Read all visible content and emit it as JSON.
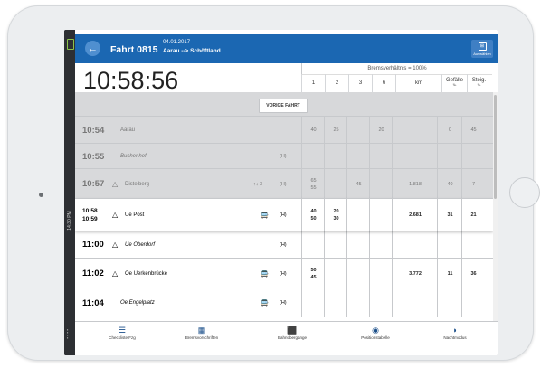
{
  "header": {
    "back_icon": "arrow-left-icon",
    "trip_title": "Fahrt 0815",
    "date": "04.01.2017",
    "route": "Aarau --> Schöftland",
    "select_label": "Auswählen",
    "brand_color": "#1b67b2"
  },
  "status": {
    "time_vertical": "14:30 PM"
  },
  "clock": "10:58:56",
  "brake_ratio": "Bremsverhältnis = 100%",
  "columns": [
    {
      "label": "1",
      "sub": ""
    },
    {
      "label": "2",
      "sub": ""
    },
    {
      "label": "3",
      "sub": ""
    },
    {
      "label": "6",
      "sub": ""
    },
    {
      "label": "km",
      "sub": ""
    },
    {
      "label": "Gefälle",
      "sub": "‰"
    },
    {
      "label": "Steig.",
      "sub": "‰"
    }
  ],
  "prev_button": "VORIGE FAHRT",
  "rows": [
    {
      "state": "past",
      "time": "10:54",
      "time2": "",
      "symbol": "",
      "name": "Aarau",
      "italic": false,
      "bus": false,
      "arrows": "",
      "h": "",
      "cells": [
        "40",
        "25",
        "",
        "20",
        "",
        "0",
        "45"
      ]
    },
    {
      "state": "past",
      "time": "10:55",
      "time2": "",
      "symbol": "",
      "name": "Buchenhof",
      "italic": true,
      "bus": false,
      "arrows": "",
      "h": "(H)",
      "cells": [
        "",
        "",
        "",
        "",
        "",
        "",
        ""
      ]
    },
    {
      "state": "past",
      "time": "10:57",
      "time2": "",
      "symbol": "△",
      "name": "Distelberg",
      "italic": false,
      "bus": false,
      "arrows": "↑↓ 3",
      "h": "(H)",
      "cells": [
        "65\n55",
        "",
        "45",
        "",
        "1.818",
        "40",
        "7"
      ]
    },
    {
      "state": "current",
      "time": "10:58",
      "time2": "10:59",
      "symbol": "△",
      "name": "Ue Post",
      "italic": false,
      "bus": true,
      "arrows": "",
      "h": "(H)",
      "cells": [
        "40\n50",
        "20\n30",
        "",
        "",
        "2.681",
        "31",
        "21"
      ]
    },
    {
      "state": "future",
      "time": "11:00",
      "time2": "",
      "symbol": "△",
      "name": "Ue Oberdorf",
      "italic": true,
      "bus": false,
      "arrows": "",
      "h": "(H)",
      "cells": [
        "",
        "",
        "",
        "",
        "",
        "",
        ""
      ]
    },
    {
      "state": "future",
      "time": "11:02",
      "time2": "",
      "symbol": "△",
      "name": "Oe Uerkenbrücke",
      "italic": false,
      "bus": true,
      "arrows": "",
      "h": "(H)",
      "cells": [
        "50\n45",
        "",
        "",
        "",
        "3.772",
        "11",
        "36"
      ]
    },
    {
      "state": "future",
      "time": "11:04",
      "time2": "",
      "symbol": "",
      "name": "Oe Engelplatz",
      "italic": true,
      "bus": true,
      "arrows": "",
      "h": "(H)",
      "cells": [
        "",
        "",
        "",
        "",
        "",
        "",
        ""
      ]
    }
  ],
  "nav": [
    {
      "icon": "checklist-icon",
      "glyph": "☰",
      "label": "Checkliste Fzg"
    },
    {
      "icon": "table-icon",
      "glyph": "▦",
      "label": "Bremsvorschriften"
    },
    {
      "icon": "railway-crossing-icon",
      "glyph": "⬛",
      "label": "Bahnübergänge"
    },
    {
      "icon": "position-icon",
      "glyph": "◉",
      "label": "Positionstabelle"
    },
    {
      "icon": "night-mode-icon",
      "glyph": "◗",
      "label": "Nachtmodus"
    }
  ]
}
